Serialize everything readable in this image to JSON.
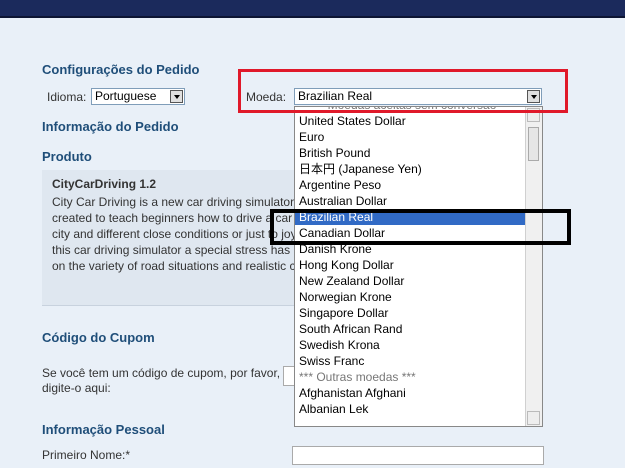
{
  "order_settings": {
    "title": "Configurações do Pedido",
    "language_label": "Idioma:",
    "language_value": "Portuguese",
    "currency_label": "Moeda:",
    "currency_value": "Brazilian Real"
  },
  "order_info": {
    "title": "Informação do Pedido"
  },
  "product": {
    "title": "Produto",
    "name": "CityCarDriving 1.2",
    "description": "City Car Driving is a new car driving simulator game, created to teach beginners how to drive a car in a big city and different close conditions or just to joy ride. In this car driving simulator a special stress has been laid on the variety of road situations and realistic car driving"
  },
  "coupon": {
    "title": "Código do Cupom",
    "text": "Se você tem um código de cupom, por favor, digite-o aqui:"
  },
  "personal": {
    "title": "Informação Pessoal",
    "first_name_label": "Primeiro Nome:*"
  },
  "currency_dropdown": {
    "items": [
      {
        "label": "Moedas aceitas sem conversão",
        "kind": "group"
      },
      {
        "label": "United States Dollar",
        "kind": "option"
      },
      {
        "label": "Euro",
        "kind": "option"
      },
      {
        "label": "British Pound",
        "kind": "option"
      },
      {
        "label": "日本円 (Japanese Yen)",
        "kind": "option"
      },
      {
        "label": "Argentine Peso",
        "kind": "option"
      },
      {
        "label": "Australian Dollar",
        "kind": "option"
      },
      {
        "label": "Brazilian Real",
        "kind": "selected"
      },
      {
        "label": "Canadian Dollar",
        "kind": "option"
      },
      {
        "label": "Danish Krone",
        "kind": "option"
      },
      {
        "label": "Hong Kong Dollar",
        "kind": "option"
      },
      {
        "label": "New Zealand Dollar",
        "kind": "option"
      },
      {
        "label": "Norwegian Krone",
        "kind": "option"
      },
      {
        "label": "Singapore Dollar",
        "kind": "option"
      },
      {
        "label": "South African Rand",
        "kind": "option"
      },
      {
        "label": "Swedish Krona",
        "kind": "option"
      },
      {
        "label": "Swiss Franc",
        "kind": "option"
      },
      {
        "label": "*** Outras moedas ***",
        "kind": "group"
      },
      {
        "label": "Afghanistan Afghani",
        "kind": "option"
      },
      {
        "label": "Albanian Lek",
        "kind": "option"
      }
    ]
  }
}
